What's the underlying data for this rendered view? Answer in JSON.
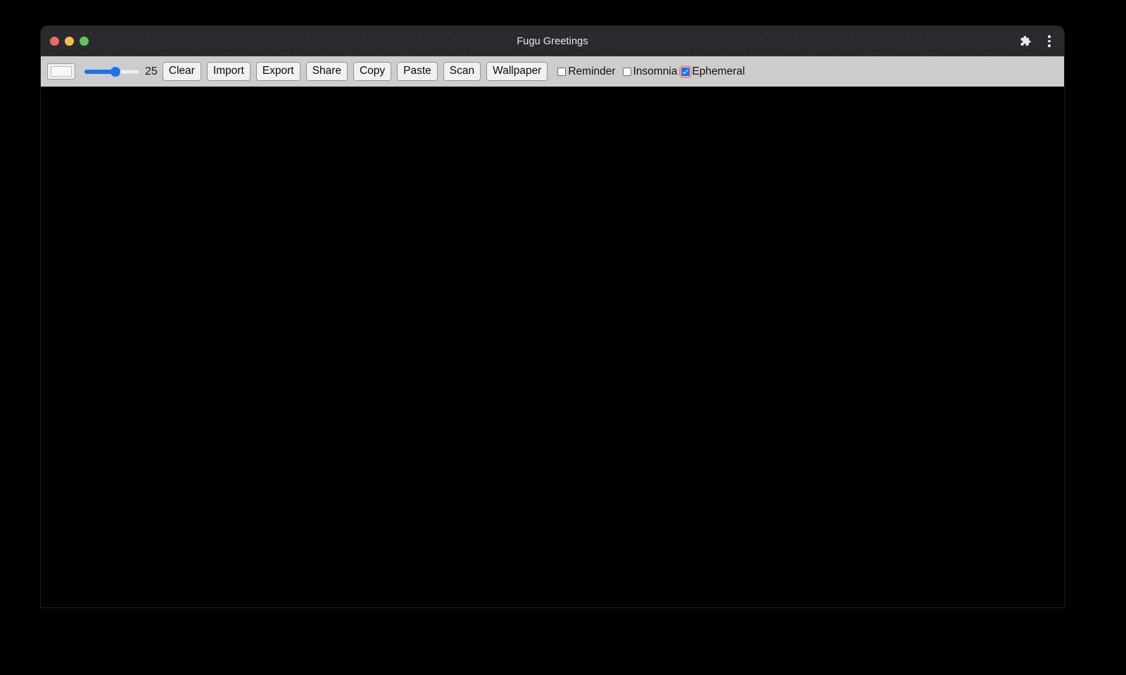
{
  "window": {
    "title": "Fugu Greetings",
    "traffic_lights": [
      {
        "name": "close",
        "color": "#ed6a5e"
      },
      {
        "name": "minimize",
        "color": "#f4bd4f"
      },
      {
        "name": "maximize",
        "color": "#61c454"
      }
    ],
    "title_actions": [
      {
        "name": "extensions-icon",
        "label": "Extensions"
      },
      {
        "name": "browser-menu-icon",
        "label": "More options"
      }
    ]
  },
  "toolbar": {
    "color_picker": {
      "name": "color-input",
      "value": "#f7f7f7"
    },
    "line_width": {
      "name": "line-width-slider",
      "value": "25",
      "min": "1",
      "max": "50",
      "percent": 50
    },
    "buttons": [
      {
        "name": "clear-button",
        "label": "Clear"
      },
      {
        "name": "import-button",
        "label": "Import"
      },
      {
        "name": "export-button",
        "label": "Export"
      },
      {
        "name": "share-button",
        "label": "Share"
      },
      {
        "name": "copy-button",
        "label": "Copy"
      },
      {
        "name": "paste-button",
        "label": "Paste"
      },
      {
        "name": "scan-button",
        "label": "Scan"
      },
      {
        "name": "wallpaper-button",
        "label": "Wallpaper"
      }
    ],
    "checkboxes": [
      {
        "name": "reminder-checkbox",
        "label": "Reminder",
        "checked": false,
        "focused": false
      },
      {
        "name": "insomnia-checkbox",
        "label": "Insomnia",
        "checked": false,
        "focused": false
      },
      {
        "name": "ephemeral-checkbox",
        "label": "Ephemeral",
        "checked": true,
        "focused": true
      }
    ]
  },
  "canvas": {
    "name": "drawing-canvas",
    "background": "#000000"
  },
  "colors": {
    "titlebar_bg": "#292a2d",
    "toolbar_bg": "#cdcdcd",
    "accent": "#1a73e8",
    "focus_ring": "#f08b7e",
    "canvas_bg": "#000000"
  }
}
